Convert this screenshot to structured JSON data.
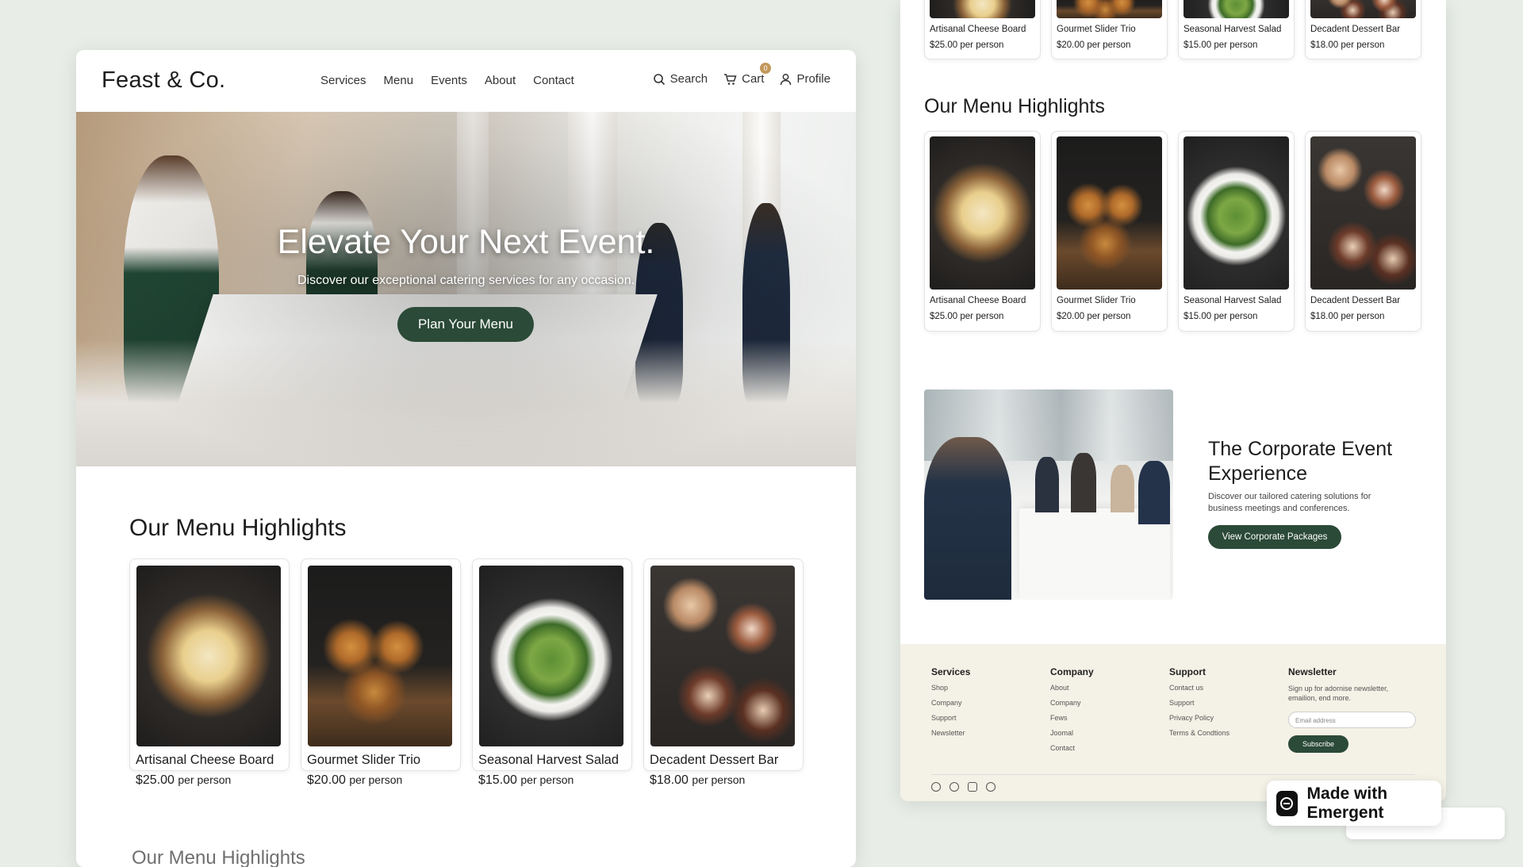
{
  "brand": "Feast & Co.",
  "nav": {
    "links": [
      "Services",
      "Menu",
      "Events",
      "About",
      "Contact"
    ],
    "search_label": "Search",
    "cart_label": "Cart",
    "cart_count": "0",
    "profile_label": "Profile"
  },
  "hero": {
    "title": "Elevate Your Next Event.",
    "subtitle": "Discover our exceptional catering services for any occasion.",
    "cta_label": "Plan Your Menu"
  },
  "menu_section": {
    "title": "Our Menu Highlights",
    "unit": "per person",
    "items": [
      {
        "name": "Artisanal Cheese Board",
        "price": "$25.00"
      },
      {
        "name": "Gourmet Slider Trio",
        "price": "$20.00"
      },
      {
        "name": "Seasonal Harvest Salad",
        "price": "$15.00"
      },
      {
        "name": "Decadent Dessert Bar",
        "price": "$18.00"
      }
    ]
  },
  "next_section_partial": "Our Menu Highlights",
  "corporate": {
    "title": "The Corporate Event Experience",
    "subtitle": "Discover our tailored catering solutions for business meetings and conferences.",
    "cta_label": "View Corporate Packages"
  },
  "footer": {
    "columns": [
      {
        "title": "Services",
        "links": [
          "Shop",
          "Company",
          "Support",
          "Newsletter"
        ]
      },
      {
        "title": "Company",
        "links": [
          "About",
          "Company",
          "Fews",
          "Joomal",
          "Contact"
        ]
      },
      {
        "title": "Support",
        "links": [
          "Contact us",
          "Support",
          "Privacy Policy",
          "Terms & Condtions"
        ]
      }
    ],
    "newsletter": {
      "title": "Newsletter",
      "text": "Sign up for adornise newsletter, emailion, end more.",
      "email_placeholder": "Email address",
      "subscribe_label": "Subscribe"
    },
    "social_icons": [
      "facebook-icon",
      "facebook-icon",
      "instagram-icon",
      "pinterest-icon"
    ]
  },
  "made_with": "Made with Emergent",
  "colors": {
    "accent_green": "#2b4a37",
    "footer_bg": "#f4f1e6",
    "page_bg": "#e8ede7",
    "badge": "#c2985a"
  }
}
